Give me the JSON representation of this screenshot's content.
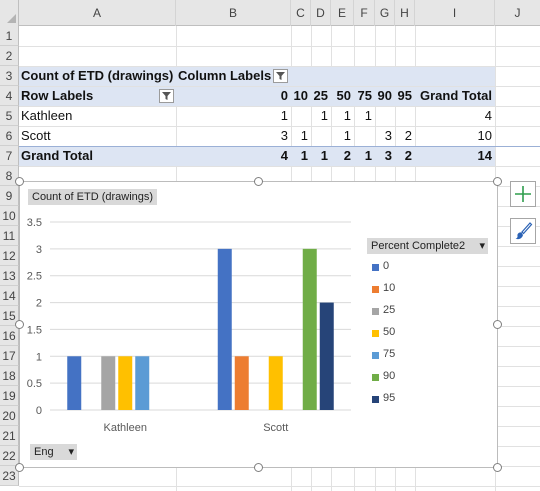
{
  "columns": [
    "A",
    "B",
    "C",
    "D",
    "E",
    "F",
    "G",
    "H",
    "I",
    "J"
  ],
  "rows": [
    "1",
    "2",
    "3",
    "4",
    "5",
    "6",
    "7",
    "8",
    "9",
    "10",
    "11",
    "12",
    "13",
    "14",
    "15",
    "16",
    "17",
    "18",
    "19",
    "20",
    "21",
    "22",
    "23"
  ],
  "pivot": {
    "title": "Count of ETD (drawings)",
    "column_labels": "Column Labels",
    "row_labels": "Row Labels",
    "headers": [
      "0",
      "10",
      "25",
      "50",
      "75",
      "90",
      "95",
      "Grand Total"
    ],
    "rows": [
      {
        "label": "Kathleen",
        "cells": [
          "1",
          "",
          "1",
          "1",
          "1",
          "",
          "",
          ""
        ],
        "total": "4"
      },
      {
        "label": "Scott",
        "cells": [
          "3",
          "1",
          "",
          "1",
          "",
          "3",
          "2",
          ""
        ],
        "total": "10"
      }
    ],
    "grand_total_label": "Grand Total",
    "grand_totals": [
      "4",
      "1",
      "1",
      "2",
      "1",
      "3",
      "2"
    ],
    "grand_total_all": "14"
  },
  "chart": {
    "value_field": "Count of ETD (drawings)",
    "legend_field": "Percent Complete2",
    "axis_field": "Eng",
    "colors": {
      "0": "#4472c4",
      "10": "#ed7d31",
      "25": "#a5a5a5",
      "50": "#ffc000",
      "75": "#5b9bd5",
      "90": "#70ad47",
      "95": "#264478"
    }
  },
  "chart_data": {
    "type": "bar",
    "categories": [
      "Kathleen",
      "Scott"
    ],
    "series": [
      {
        "name": "0",
        "values": [
          1,
          3
        ]
      },
      {
        "name": "10",
        "values": [
          0,
          1
        ]
      },
      {
        "name": "25",
        "values": [
          1,
          0
        ]
      },
      {
        "name": "50",
        "values": [
          1,
          1
        ]
      },
      {
        "name": "75",
        "values": [
          1,
          0
        ]
      },
      {
        "name": "90",
        "values": [
          0,
          3
        ]
      },
      {
        "name": "95",
        "values": [
          0,
          2
        ]
      }
    ],
    "title": "",
    "xlabel": "",
    "ylabel": "",
    "ylim": [
      0,
      3.5
    ],
    "yticks": [
      "0",
      "0.5",
      "1",
      "1.5",
      "2",
      "2.5",
      "3",
      "3.5"
    ],
    "grid": true,
    "legend": "right"
  },
  "icons": {
    "chart_elements": "plus-icon",
    "chart_styles": "paintbrush-icon",
    "filter": "filter-icon"
  }
}
